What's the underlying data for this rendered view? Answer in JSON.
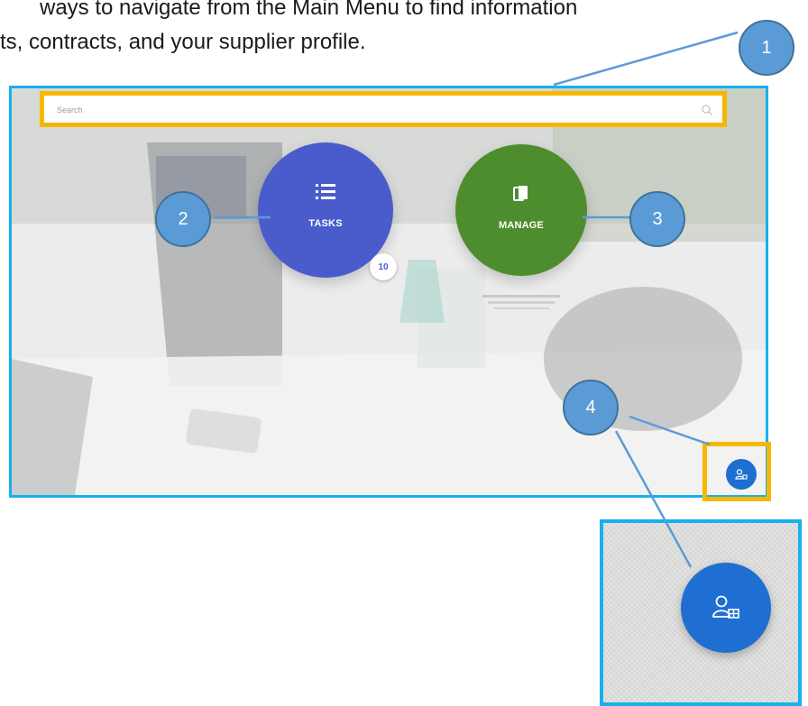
{
  "intro": {
    "line1": "ways to navigate from the Main Menu to find information",
    "line2": "ts, contracts, and your supplier profile."
  },
  "search": {
    "placeholder": "Search",
    "icon": "search-icon"
  },
  "tiles": {
    "tasks": {
      "label": "TASKS",
      "icon": "list-icon",
      "color": "#4a5ccc",
      "badge": "10"
    },
    "manage": {
      "label": "MANAGE",
      "icon": "documents-icon",
      "color": "#4e8d2d"
    }
  },
  "profile_button": {
    "icon": "supplier-profile-icon",
    "color": "#1e6fd1"
  },
  "callouts": [
    {
      "number": "1"
    },
    {
      "number": "2"
    },
    {
      "number": "3"
    },
    {
      "number": "4"
    }
  ],
  "colors": {
    "highlight": "#f5b800",
    "frame": "#18b0ee",
    "callout": "#5b9bd5"
  }
}
